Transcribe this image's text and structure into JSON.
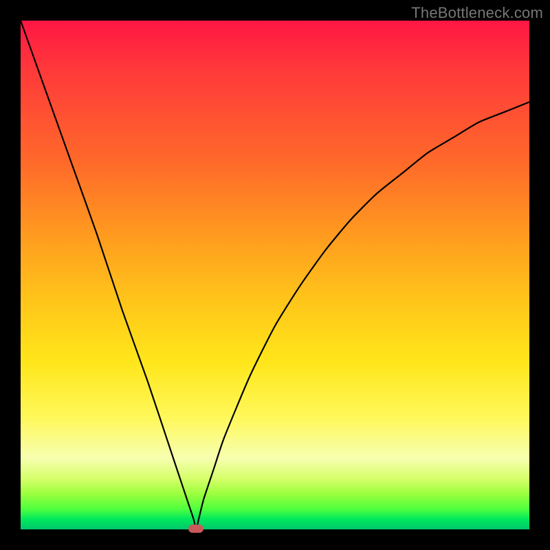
{
  "watermark_text": "TheBottleneck.com",
  "colors": {
    "frame_bg": "#000000",
    "curve_stroke": "#000000",
    "marker_fill": "#c75a5a",
    "gradient_stops": [
      "#ff1643",
      "#ff3a3a",
      "#ff6a2a",
      "#ff9a1f",
      "#ffc51a",
      "#ffe61a",
      "#fff85a",
      "#f7ffb0",
      "#d6ff6a",
      "#9cff3e",
      "#4fff3e",
      "#00e85e",
      "#00c86b"
    ]
  },
  "chart_data": {
    "type": "line",
    "title": "",
    "xlabel": "",
    "ylabel": "",
    "xlim": [
      0,
      100
    ],
    "ylim": [
      0,
      100
    ],
    "x": [
      0,
      5,
      10,
      15,
      20,
      25,
      30,
      31,
      32,
      33,
      34,
      34.5,
      35,
      36,
      38,
      40,
      45,
      50,
      55,
      60,
      65,
      70,
      75,
      80,
      85,
      90,
      95,
      100
    ],
    "values": [
      100,
      86,
      72,
      58,
      43,
      29,
      14,
      11,
      8,
      5,
      2,
      0,
      2,
      6,
      12,
      18,
      30,
      40,
      48,
      55,
      61,
      66,
      70,
      74,
      77,
      80,
      82,
      84
    ],
    "annotations": [
      {
        "type": "marker",
        "shape": "rounded-rect",
        "x": 34.5,
        "y": 0,
        "w": 3,
        "h": 1.6
      }
    ],
    "notes": "V-shaped bottleneck curve on a vertical red→green gradient. Minimum (zero) around x≈34.5 marked by a small rounded red pill at the bottom edge. Values estimated from pixel positions; no axes, ticks, or legend are rendered."
  }
}
